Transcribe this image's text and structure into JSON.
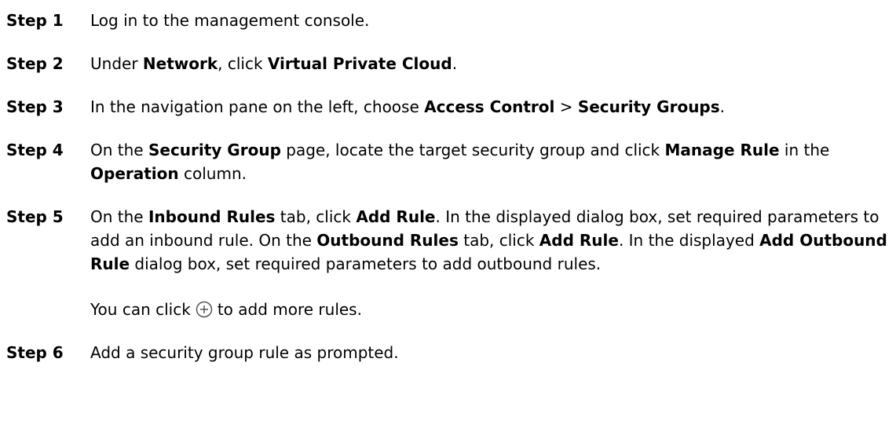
{
  "steps": [
    {
      "label": "Step 1",
      "parts": [
        {
          "t": "Log in to the management console."
        }
      ]
    },
    {
      "label": "Step 2",
      "parts": [
        {
          "t": "Under "
        },
        {
          "t": "Network",
          "b": true
        },
        {
          "t": ", click "
        },
        {
          "t": "Virtual Private Cloud",
          "b": true
        },
        {
          "t": "."
        }
      ]
    },
    {
      "label": "Step 3",
      "parts": [
        {
          "t": "In the navigation pane on the left, choose "
        },
        {
          "t": "Access Control",
          "b": true
        },
        {
          "t": " > "
        },
        {
          "t": "Security Groups",
          "b": true
        },
        {
          "t": "."
        }
      ]
    },
    {
      "label": "Step 4",
      "parts": [
        {
          "t": "On the "
        },
        {
          "t": "Security Group",
          "b": true
        },
        {
          "t": " page, locate the target security group and click "
        },
        {
          "t": "Manage Rule",
          "b": true
        },
        {
          "t": " in the "
        },
        {
          "t": "Operation",
          "b": true
        },
        {
          "t": " column."
        }
      ]
    },
    {
      "label": "Step 5",
      "parts": [
        {
          "t": "On the "
        },
        {
          "t": "Inbound Rules",
          "b": true
        },
        {
          "t": " tab, click "
        },
        {
          "t": "Add Rule",
          "b": true
        },
        {
          "t": ". In the displayed dialog box, set required parameters to add an inbound rule. On the "
        },
        {
          "t": "Outbound Rules",
          "b": true
        },
        {
          "t": " tab, click "
        },
        {
          "t": "Add Rule",
          "b": true
        },
        {
          "t": ". In the displayed "
        },
        {
          "t": "Add Outbound Rule",
          "b": true
        },
        {
          "t": " dialog box, set required parameters to add outbound rules."
        }
      ],
      "note": {
        "before": "You can click",
        "icon": "plus-circle-icon",
        "after": "to add more rules."
      }
    },
    {
      "label": "Step 6",
      "parts": [
        {
          "t": "Add a security group rule as prompted."
        }
      ]
    }
  ],
  "colors": {
    "text": "#000000",
    "icon": "#555555"
  }
}
